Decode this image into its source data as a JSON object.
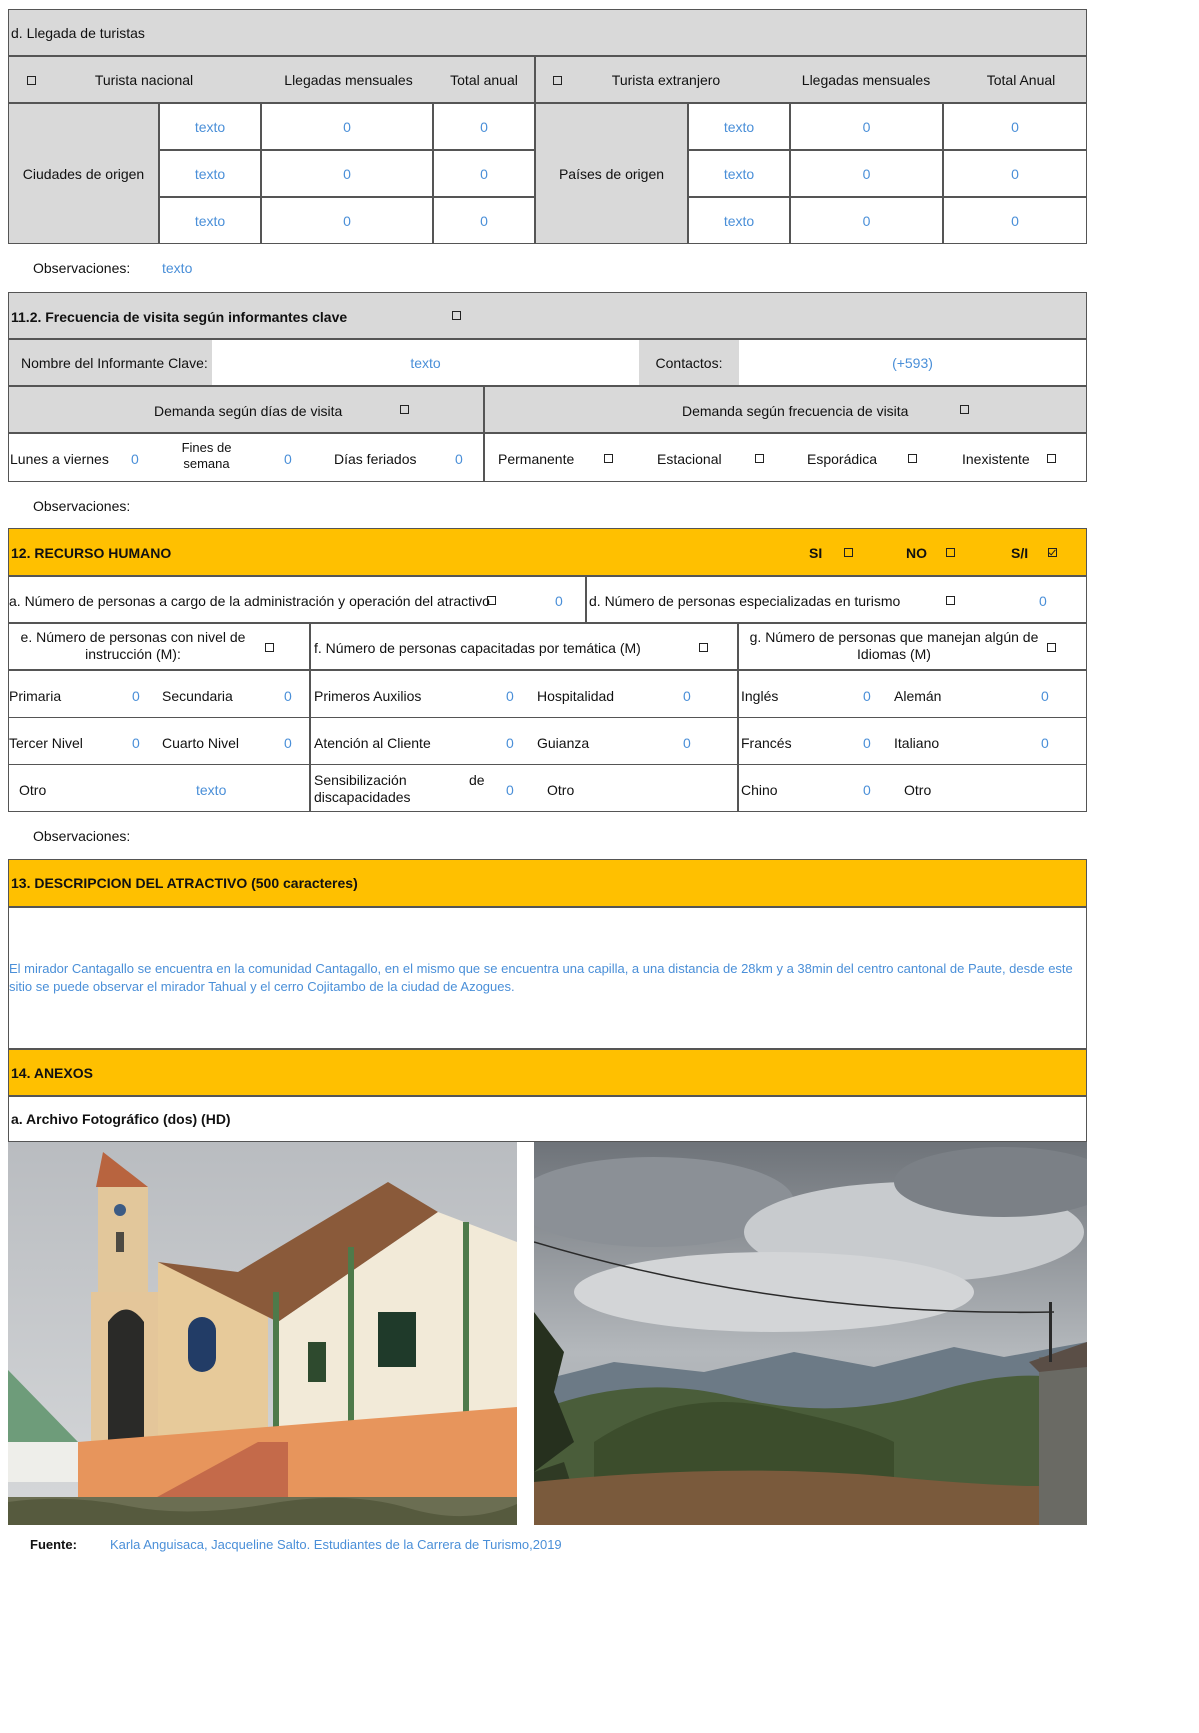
{
  "llegada": {
    "title": "d. Llegada de turistas",
    "nacional_label": "Turista nacional",
    "llegadas_mensuales": "Llegadas mensuales",
    "total_anual": "Total anual",
    "extranjero_label": "Turista extranjero",
    "llegadas_mensuales_2": "Llegadas mensuales",
    "total_anual_2": "Total Anual",
    "ciudades_label": "Ciudades de origen",
    "paises_label": "Países de origen",
    "nacional_rows": [
      {
        "origen": "texto",
        "mensual": "0",
        "anual": "0"
      },
      {
        "origen": "texto",
        "mensual": "0",
        "anual": "0"
      },
      {
        "origen": "texto",
        "mensual": "0",
        "anual": "0"
      }
    ],
    "extranjero_rows": [
      {
        "origen": "texto",
        "mensual": "0",
        "anual": "0"
      },
      {
        "origen": "texto",
        "mensual": "0",
        "anual": "0"
      },
      {
        "origen": "texto",
        "mensual": "0",
        "anual": "0"
      }
    ],
    "observaciones_label": "Observaciones:",
    "observaciones_value": "texto"
  },
  "frecuencia": {
    "title": "11.2. Frecuencia de visita según informantes clave",
    "informante_label": "Nombre del Informante Clave:",
    "informante_value": "texto",
    "contactos_label": "Contactos:",
    "contactos_value": "(+593)",
    "demanda_dias": "Demanda según  días de visita",
    "demanda_frecuencia": "Demanda según frecuencia de visita",
    "lunes": "Lunes a viernes",
    "lunes_value": "0",
    "fines": "Fines de semana",
    "fines_value": "0",
    "feriados": "Días feriados",
    "feriados_value": "0",
    "permanente": "Permanente",
    "estacional": "Estacional",
    "esporadica": "Esporádica",
    "inexistente": "Inexistente",
    "observaciones_label": "Observaciones:"
  },
  "recurso": {
    "title": "12. RECURSO HUMANO",
    "si": "SI",
    "no": "NO",
    "si_info": "S/I",
    "a_label": "a. Número de personas a cargo de la administración y operación del atractivo",
    "a_value": "0",
    "d_label": "d. Número de personas especializadas en turismo",
    "d_value": "0",
    "e_label": "e. Número de personas con nivel de instrucción (M):",
    "f_label": "f. Número de personas capacitadas por temática (M)",
    "g_label": "g. Número de personas que manejan algún de Idiomas (M)",
    "primaria": "Primaria",
    "primaria_value": "0",
    "secundaria": "Secundaria",
    "secundaria_value": "0",
    "tercer": "Tercer Nivel",
    "tercer_value": "0",
    "cuarto": "Cuarto Nivel",
    "cuarto_value": "0",
    "otro": "Otro",
    "otro_value": "texto",
    "auxilios": "Primeros Auxilios",
    "auxilios_value": "0",
    "hospitalidad": "Hospitalidad",
    "hospitalidad_value": "0",
    "atencion": "Atención al Cliente",
    "atencion_value": "0",
    "guianza": "Guianza",
    "guianza_value": "0",
    "sensibilizacion_1": "Sensibilización",
    "sensibilizacion_de": "de",
    "sensibilizacion_2": "discapacidades",
    "sensibilizacion_value": "0",
    "otro_f": "Otro",
    "ingles": "Inglés",
    "ingles_value": "0",
    "aleman": "Alemán",
    "aleman_value": "0",
    "frances": "Francés",
    "frances_value": "0",
    "italiano": "Italiano",
    "italiano_value": "0",
    "chino": "Chino",
    "chino_value": "0",
    "otro_g": "Otro",
    "observaciones_label": "Observaciones:"
  },
  "descripcion": {
    "title": "13. DESCRIPCION DEL ATRACTIVO (500 caracteres)",
    "text": "El mirador Cantagallo se encuentra en la comunidad Cantagallo, en el mismo que se encuentra una capilla, a una distancia de 28km y a 38min del centro cantonal de Paute, desde este sitio se puede observar el mirador Tahual y el cerro Cojitambo de la ciudad de Azogues."
  },
  "anexos": {
    "title": "14. ANEXOS",
    "archivo": "a. Archivo Fotográfico (dos) (HD)",
    "fuente_label": "Fuente:",
    "fuente_value": "Karla Anguisaca, Jacqueline Salto. Estudiantes de la Carrera de Turismo,2019"
  },
  "colors": {
    "accent_gold": "#ffc000",
    "header_gray": "#d9d9d9",
    "value_blue": "#4a8fd8"
  }
}
